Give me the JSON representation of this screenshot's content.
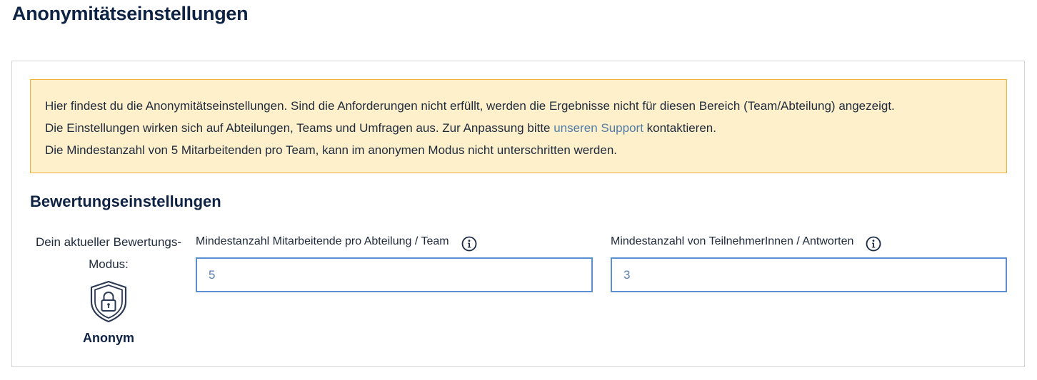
{
  "page": {
    "title": "Anonymitätseinstellungen"
  },
  "notice": {
    "line1": "Hier findest du die Anonymitätseinstellungen. Sind die Anforderungen nicht erfüllt, werden die Ergebnisse nicht für diesen Bereich (Team/Abteilung) angezeigt.",
    "line2_before": "Die Einstellungen wirken sich auf Abteilungen, Teams und Umfragen aus. Zur Anpassung bitte ",
    "line2_link": "unseren Support",
    "line2_after": " kontaktieren.",
    "line3": "Die Mindestanzahl von 5 Mitarbeitenden pro Team, kann im anonymen Modus nicht unterschritten werden."
  },
  "rating": {
    "section_title": "Bewertungseinstellungen",
    "mode_label_line1": "Dein aktueller Bewertungs-",
    "mode_label_line2": "Modus:",
    "mode_icon": "shield-lock-icon",
    "mode_value": "Anonym",
    "fields": [
      {
        "label": "Mindestanzahl Mitarbeitende pro Abteilung / Team",
        "value": "5",
        "icon": "info-icon"
      },
      {
        "label": "Mindestanzahl von TeilnehmerInnen / Antworten",
        "value": "3",
        "icon": "info-icon"
      }
    ]
  },
  "colors": {
    "title": "#0e2244",
    "notice_bg": "#fff0cc",
    "notice_border": "#f2b13a",
    "link": "#4f7ca8",
    "input_border": "#5b8fd1"
  }
}
